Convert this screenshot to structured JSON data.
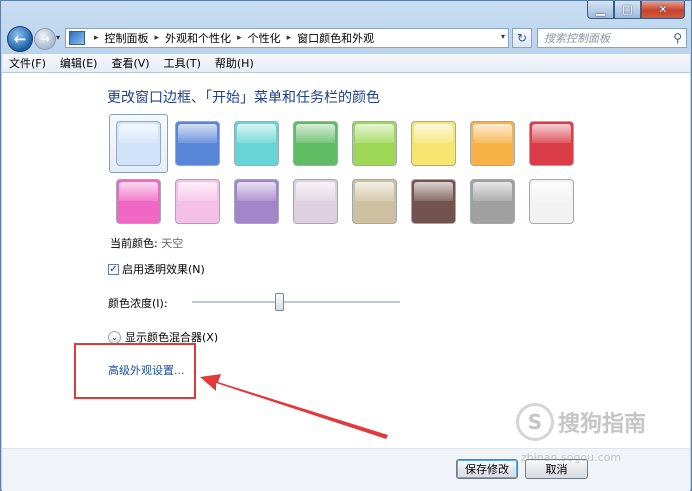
{
  "window": {
    "minimize_glyph": "▁",
    "maximize_glyph": "□",
    "close_glyph": "✕"
  },
  "nav": {
    "back_glyph": "←",
    "forward_glyph": "→",
    "history_glyph": "▾",
    "breadcrumb": [
      "控制面板",
      "外观和个性化",
      "个性化",
      "窗口颜色和外观"
    ],
    "crumb_sep": "▸",
    "dropdown_glyph": "▾",
    "refresh_glyph": "↻",
    "search_placeholder": "搜索控制面板",
    "search_glyph": "⚲"
  },
  "menubar": [
    "文件(F)",
    "编辑(E)",
    "查看(V)",
    "工具(T)",
    "帮助(H)"
  ],
  "content": {
    "title": "更改窗口边框、「开始」菜单和任务栏的颜色",
    "swatches_row1": [
      "#cfe3fa",
      "#4f7fd6",
      "#5fd3d3",
      "#58b95a",
      "#9ad64f",
      "#f6e46a",
      "#f7ad3c",
      "#d9333f"
    ],
    "swatches_row2": [
      "#f060c0",
      "#f5bde6",
      "#9f7fc7",
      "#dccfe0",
      "#cbbd9c",
      "#6c4a45",
      "#9b9b9b",
      "#f2f2f2"
    ],
    "selected_index": 0,
    "current_color_label": "当前颜色:",
    "current_color_value": "天空",
    "transparency_label": "启用透明效果(N)",
    "transparency_checked": true,
    "check_glyph": "✓",
    "intensity_label": "颜色浓度(I):",
    "intensity_fraction": 0.42,
    "mixer_glyph": "⌄",
    "mixer_label": "显示颜色混合器(X)",
    "advanced_link": "高级外观设置..."
  },
  "footer": {
    "save_label": "保存修改",
    "cancel_label": "取消"
  },
  "watermark": {
    "logo_glyph": "S",
    "text": "搜狗指南",
    "sub": "zhinan.sogou.com"
  },
  "colors": {
    "accent_link": "#1e50a2",
    "annotation_red": "#e03a3a",
    "title_blue": "#1e3f8c"
  }
}
